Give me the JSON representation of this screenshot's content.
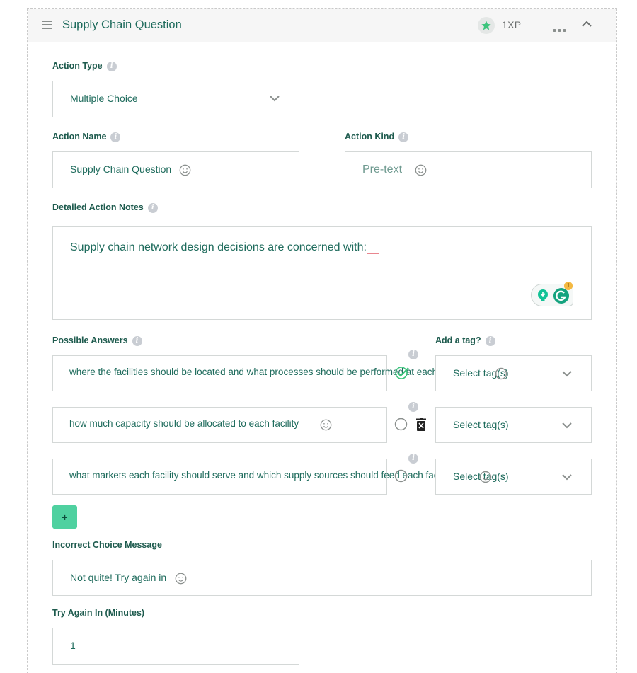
{
  "header": {
    "title": "Supply Chain Question",
    "xp": "1XP",
    "star_color": "#3cc47c"
  },
  "form": {
    "action_type": {
      "label": "Action Type",
      "value": "Multiple Choice"
    },
    "action_name": {
      "label": "Action Name",
      "value": "Supply Chain Question"
    },
    "action_kind": {
      "label": "Action Kind",
      "placeholder": "Pre-text"
    },
    "notes": {
      "label": "Detailed Action Notes",
      "value": "Supply chain network design decisions are concerned with:",
      "grammarly_count": "1"
    },
    "answers_label": "Possible Answers",
    "tag_label": "Add a tag?",
    "answers": [
      {
        "text": "where the facilities should be located and what processes should be performed at each",
        "correct": true,
        "tag_placeholder": "Select tag(s)"
      },
      {
        "text": "how much capacity should be allocated to each facility",
        "correct": false,
        "tag_placeholder": "Select tag(s)"
      },
      {
        "text": "what markets each facility should serve and which supply sources should feed each facility",
        "correct": false,
        "tag_placeholder": "Select tag(s)"
      }
    ],
    "add_answer_label": "+",
    "incorrect_msg": {
      "label": "Incorrect Choice Message",
      "value": "Not quite! Try again in"
    },
    "try_again": {
      "label": "Try Again In (Minutes)",
      "value": "1"
    }
  },
  "colors": {
    "accent": "#4fd1a0",
    "text": "#1e6b5c",
    "border": "#d4d8d7"
  }
}
